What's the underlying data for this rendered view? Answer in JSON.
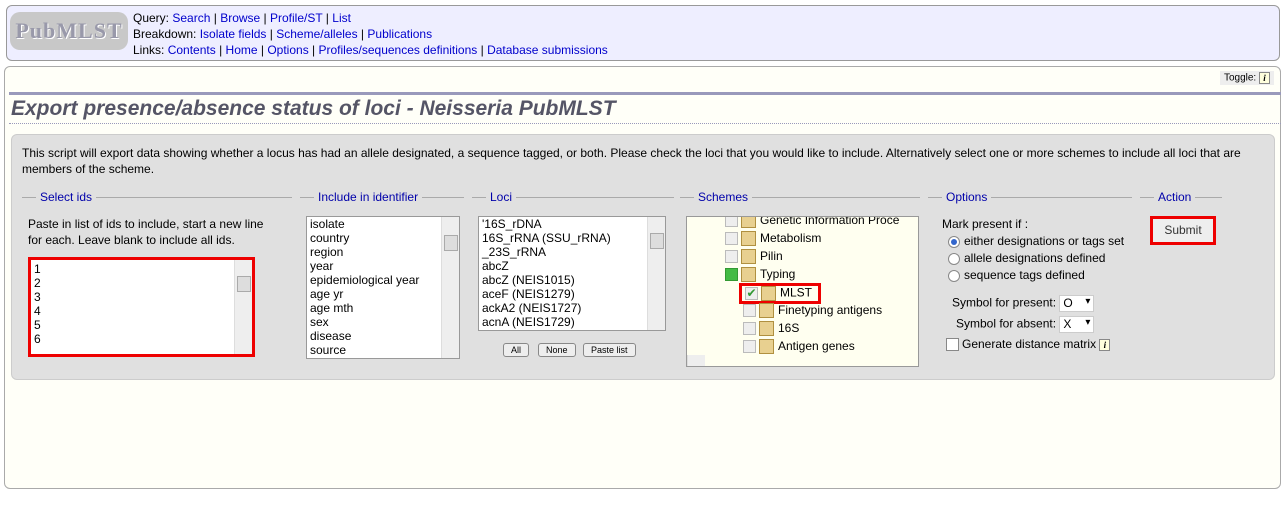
{
  "header": {
    "logo": "PubMLST",
    "query_label": "Query:",
    "query_links": [
      "Search",
      "Browse",
      "Profile/ST",
      "List"
    ],
    "breakdown_label": "Breakdown:",
    "breakdown_links": [
      "Isolate fields",
      "Scheme/alleles",
      "Publications"
    ],
    "links_label": "Links:",
    "links": [
      "Contents",
      "Home",
      "Options",
      "Profiles/sequences definitions",
      "Database submissions"
    ]
  },
  "toggle": "Toggle:",
  "title": "Export presence/absence status of loci - Neisseria PubMLST",
  "intro": "This script will export data showing whether a locus has had an allele designated, a sequence tagged, or both. Please check the loci that you would like to include. Alternatively select one or more schemes to include all loci that are members of the scheme.",
  "select_ids": {
    "legend": "Select ids",
    "help": "Paste in list of ids to include, start a new line for each. Leave blank to include all ids.",
    "values": [
      "1",
      "2",
      "3",
      "4",
      "5",
      "6"
    ]
  },
  "identifier": {
    "legend": "Include in identifier",
    "items": [
      "isolate",
      "country",
      "region",
      "year",
      "epidemiological year",
      "age yr",
      "age mth",
      "sex",
      "disease",
      "source"
    ]
  },
  "loci": {
    "legend": "Loci",
    "items": [
      "'16S_rDNA",
      "16S_rRNA (SSU_rRNA)",
      "_23S_rRNA",
      "abcZ",
      "abcZ (NEIS1015)",
      "aceF (NEIS1279)",
      "ackA2 (NEIS1727)",
      "acnA (NEIS1729)"
    ],
    "buttons": [
      "All",
      "None",
      "Paste list"
    ]
  },
  "schemes": {
    "legend": "Schemes",
    "items": [
      "Genetic Information Proce",
      "Metabolism",
      "Pilin",
      "Typing",
      "MLST",
      "Finetyping antigens",
      "16S",
      "Antigen genes"
    ]
  },
  "options": {
    "legend": "Options",
    "mark_label": "Mark present if :",
    "radios": [
      "either designations or tags set",
      "allele designations defined",
      "sequence tags defined"
    ],
    "present_label": "Symbol for present:",
    "present_value": "O",
    "absent_label": "Symbol for absent:",
    "absent_value": "X",
    "matrix_label": "Generate distance matrix"
  },
  "action": {
    "legend": "Action",
    "submit": "Submit"
  },
  "colors": {
    "highlight": "#ee0000",
    "link": "#0000cc",
    "legend": "#0000aa"
  }
}
